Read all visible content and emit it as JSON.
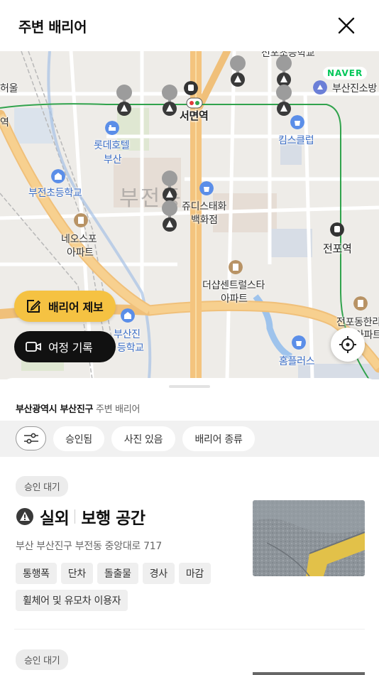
{
  "header": {
    "title": "주변 배리어"
  },
  "map": {
    "provider_logo": "NAVER",
    "labels": {
      "top_cut": "전포초등학교",
      "busanjin_fire": "부산진소방",
      "seomyeon_stn": "서면역",
      "left_edge_top": "허울",
      "left_edge_stn": "역",
      "kimsclub": "킴스클럽",
      "lotte_hotel_1": "롯데호텔",
      "lotte_hotel_2": "부산",
      "bujeon_school": "부전초등학교",
      "district": "부전동",
      "judies_1": "쥬디스태화",
      "judies_2": "백화점",
      "neosfo_1": "네오스포",
      "neosfo_2": "아파트",
      "jeonpo_stn": "전포역",
      "thesharp_1": "더샵센트럴스타",
      "thesharp_2": "아파트",
      "jeonpo_hanra_1": "전포동한라",
      "jeonpo_hanra_2": "아파트",
      "busanjin_school_1": "부산진",
      "busanjin_school_2": "등학교",
      "homeplus": "홈플러스"
    },
    "buttons": {
      "report_label": "배리어 제보",
      "journey_label": "여정 기록"
    }
  },
  "sheet": {
    "location_bold": "부산광역시 부산진구",
    "location_suffix": "주변 배리어",
    "filters": [
      "승인됨",
      "사진 있음",
      "배리어 종류"
    ]
  },
  "cards": [
    {
      "status": "승인 대기",
      "category": "실외",
      "type": "보행 공간",
      "address": "부산 부산진구 부전동 중앙대로 717",
      "tags": [
        "통행폭",
        "단차",
        "돌출물",
        "경사",
        "마감",
        "휠체어 및 유모차 이용자"
      ]
    },
    {
      "status": "승인 대기"
    }
  ],
  "colors": {
    "accent_yellow": "#f5c242",
    "dark_button": "#111111",
    "naver_green": "#03c75a",
    "subway_line": "#31a34d",
    "main_road": "#f2c584"
  }
}
